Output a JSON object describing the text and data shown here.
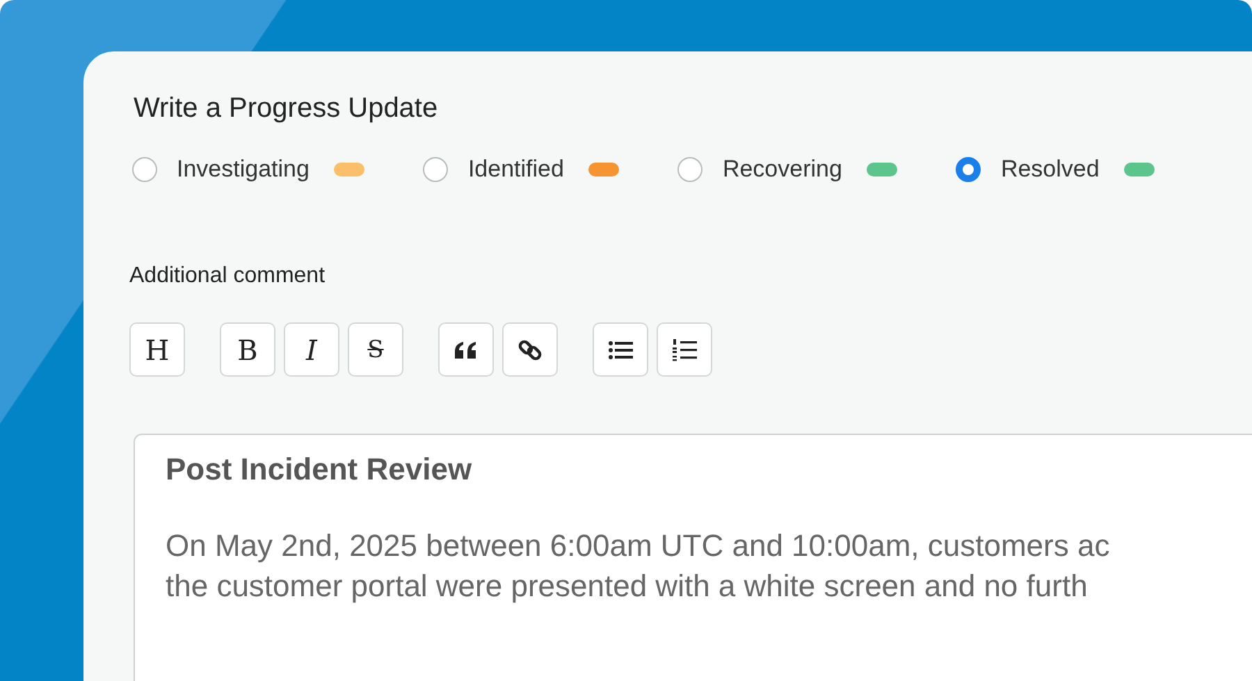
{
  "title": "Write a Progress Update",
  "statuses": [
    {
      "label": "Investigating",
      "selected": false,
      "color": "#fbbf6a"
    },
    {
      "label": "Identified",
      "selected": false,
      "color": "#f59430"
    },
    {
      "label": "Recovering",
      "selected": false,
      "color": "#5cc58c"
    },
    {
      "label": "Resolved",
      "selected": true,
      "color": "#5cc58c"
    }
  ],
  "comment_label": "Additional comment",
  "toolbar_groups": [
    [
      {
        "kind": "heading",
        "label": "H"
      }
    ],
    [
      {
        "kind": "bold",
        "label": "B"
      },
      {
        "kind": "italic",
        "label": "I"
      },
      {
        "kind": "strike",
        "label": "S"
      }
    ],
    [
      {
        "kind": "quote"
      },
      {
        "kind": "link"
      }
    ],
    [
      {
        "kind": "bullet-list"
      },
      {
        "kind": "numbered-list"
      }
    ]
  ],
  "editor": {
    "heading": "Post Incident Review",
    "lines": [
      "On May 2nd, 2025 between 6:00am UTC and 10:00am, customers ac",
      "the customer portal were presented with a white screen and no furth"
    ]
  }
}
